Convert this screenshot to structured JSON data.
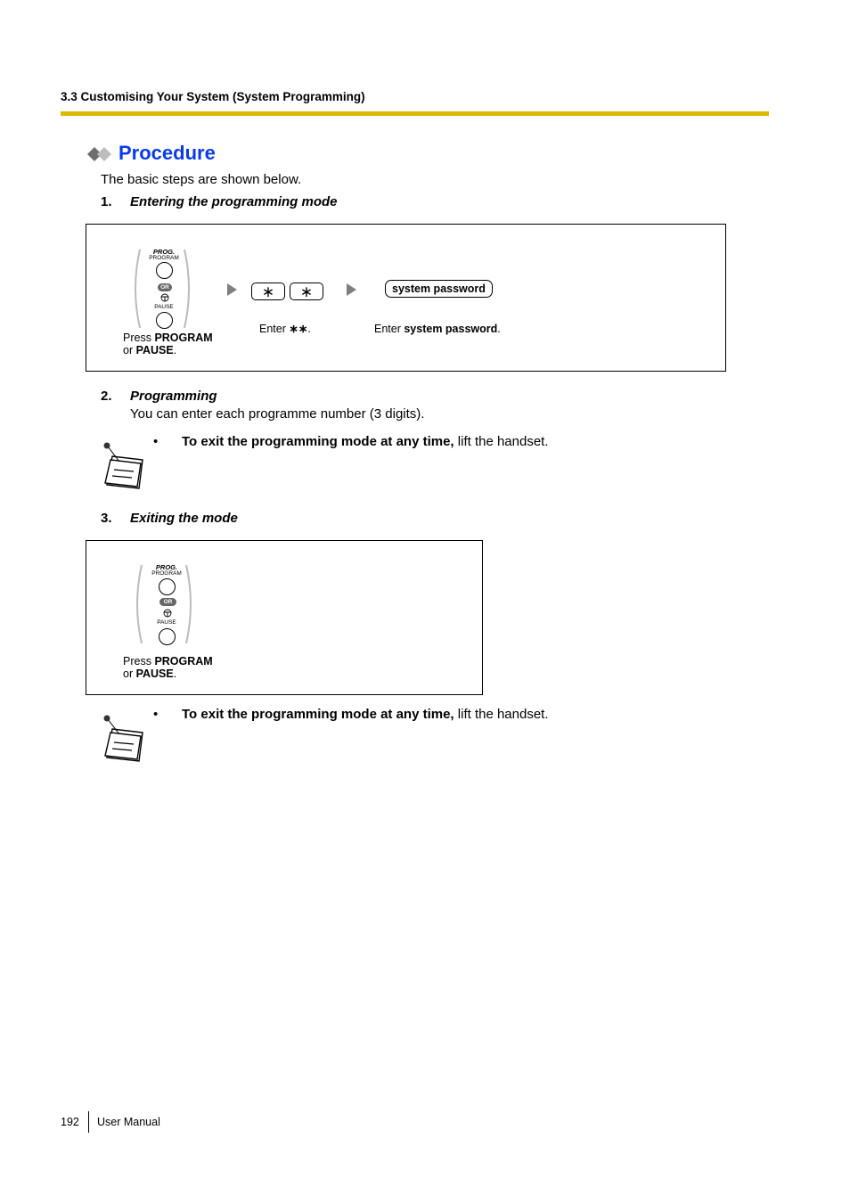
{
  "header": {
    "section": "3.3 Customising Your System (System Programming)",
    "rule_color": "#dcb800"
  },
  "procedure": {
    "title": "Procedure",
    "title_color": "#0a3be8",
    "icon": "double-diamond-icon",
    "intro": "The basic steps are shown below."
  },
  "steps": [
    {
      "number": "1.",
      "title": "Entering the programming mode",
      "diagram": {
        "key_group": {
          "top_label_italic": "PROG.",
          "top_label": "PROGRAM",
          "or_label": "OR",
          "bottom_label": "PAUSE",
          "caption_prefix": "Press ",
          "caption_bold1": "PROGRAM",
          "caption_line2_prefix": "or ",
          "caption_bold2": "PAUSE",
          "caption_suffix": "."
        },
        "star_keys": [
          "∗",
          "∗"
        ],
        "star_caption_prefix": "Enter ",
        "star_caption_glyphs": "∗∗",
        "star_caption_suffix": ".",
        "password_key": "system password",
        "password_caption_prefix": "Enter ",
        "password_caption_bold": "system password",
        "password_caption_suffix": "."
      }
    },
    {
      "number": "2.",
      "title": "Programming",
      "body": "You can enter each programme number (3 digits).",
      "note": {
        "bullet": "•",
        "bold": "To exit the programming mode at any time,",
        "rest": " lift the handset."
      }
    },
    {
      "number": "3.",
      "title": "Exiting the mode",
      "diagram": {
        "key_group": {
          "top_label_italic": "PROG.",
          "top_label": "PROGRAM",
          "or_label": "OR",
          "bottom_label": "PAUSE",
          "caption_prefix": "Press ",
          "caption_bold1": "PROGRAM",
          "caption_line2_prefix": "or ",
          "caption_bold2": "PAUSE",
          "caption_suffix": "."
        }
      },
      "note": {
        "bullet": "•",
        "bold": "To exit the programming mode at any time,",
        "rest": " lift the handset."
      }
    }
  ],
  "footer": {
    "page_number": "192",
    "label": "User Manual"
  }
}
